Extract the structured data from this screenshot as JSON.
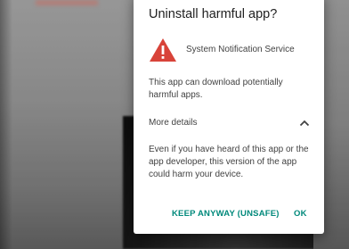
{
  "dialog": {
    "title": "Uninstall harmful app?",
    "app_name": "System Notification Service",
    "description": "This app can download potentially harmful apps.",
    "details_label": "More details",
    "details_text": "Even if you have heard of this app or the app developer, this version of the app could harm your device.",
    "keep_button": "KEEP ANYWAY (UNSAFE)",
    "ok_button": "OK"
  },
  "icons": {
    "warning": "warning-triangle-icon",
    "chevron": "chevron-up-icon"
  },
  "colors": {
    "accent": "#00897b",
    "warning": "#d84339",
    "dialog_bg": "#ffffff",
    "title_text": "#212121",
    "body_text": "#424242"
  }
}
